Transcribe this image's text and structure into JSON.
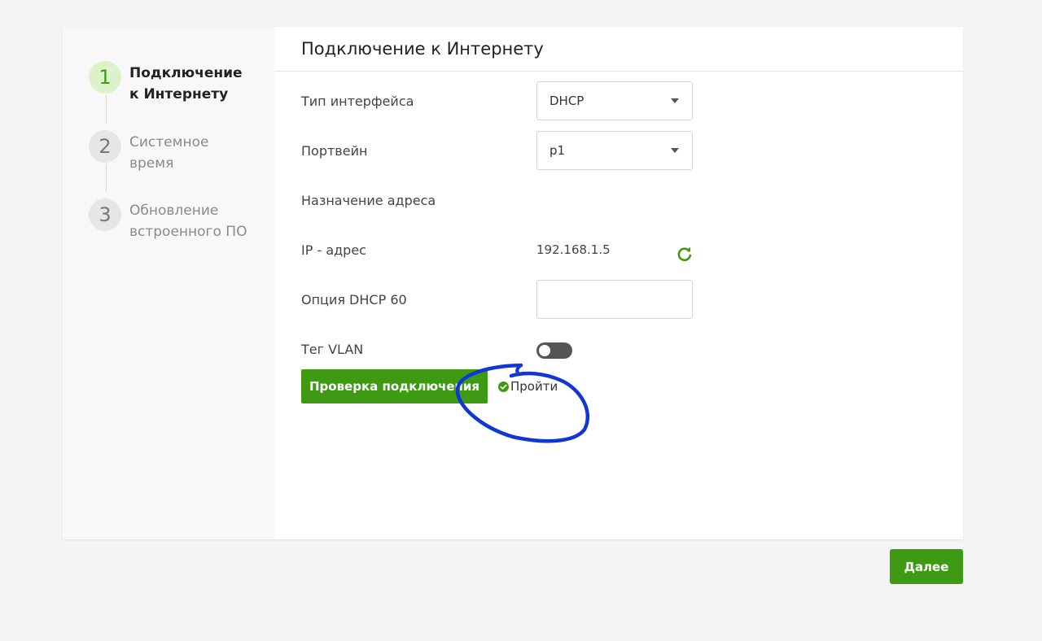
{
  "steps": [
    {
      "number": "1",
      "label": "Подключение к Интернету",
      "active": true
    },
    {
      "number": "2",
      "label": "Системное время",
      "active": false
    },
    {
      "number": "3",
      "label": "Обновление встроенного ПО",
      "active": false
    }
  ],
  "header": {
    "title": "Подключение к Интернету"
  },
  "form": {
    "interface_type": {
      "label": "Тип интерфейса",
      "value": "DHCP"
    },
    "portway": {
      "label": "Портвейн",
      "value": "p1"
    },
    "address_assignment": {
      "label": "Назначение адреса"
    },
    "ip_address": {
      "label": "IP - адрес",
      "value": "192.168.1.5"
    },
    "dhcp_option_60": {
      "label": "Опция DHCP 60",
      "value": ""
    },
    "vlan_tag": {
      "label": "Тег VLAN",
      "enabled": false
    }
  },
  "actions": {
    "check_connection_label": "Проверка подключения",
    "result_label": "Пройти",
    "next_label": "Далее"
  },
  "colors": {
    "accent": "#3e9a13",
    "annotation": "#1036d6"
  }
}
